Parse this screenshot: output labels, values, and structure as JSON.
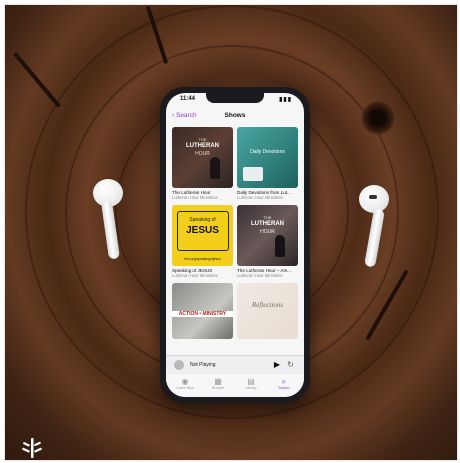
{
  "status": {
    "time": "11:44",
    "signal": "▮▮▮"
  },
  "nav": {
    "back_label": "Search",
    "title": "Shows"
  },
  "shows": [
    {
      "name": "The Lutheran Hour",
      "publisher": "Lutheran Hour Ministries",
      "art_top": "THE",
      "art_main": "LUTHERAN",
      "art_bottom": "HOUR"
    },
    {
      "name": "Daily Devotions from Lut...",
      "publisher": "Lutheran Hour Ministries",
      "art_main": "Daily Devotions"
    },
    {
      "name": "Speaking of JESUS",
      "publisher": "Lutheran Hour Ministries",
      "art_top": "Speaking of",
      "art_main": "JESUS",
      "art_bottom": "lhm.org/speakingofjesus"
    },
    {
      "name": "The Lutheran Hour – Am...",
      "publisher": "Lutheran Hour Ministries",
      "art_top": "THE",
      "art_main": "LUTHERAN",
      "art_bottom": "HOUR"
    },
    {
      "name": "",
      "publisher": "",
      "art_main": "ACTION • MINISTRY"
    },
    {
      "name": "",
      "publisher": "",
      "art_main": "Reflections"
    }
  ],
  "player": {
    "now_playing": "Not Playing"
  },
  "tabs": [
    {
      "label": "Listen Now",
      "icon": "◉",
      "active": false
    },
    {
      "label": "Browse",
      "icon": "▦",
      "active": false
    },
    {
      "label": "Library",
      "icon": "▤",
      "active": false
    },
    {
      "label": "Search",
      "icon": "⌕",
      "active": true
    }
  ],
  "colors": {
    "accent": "#8b3fd1",
    "wood": "#5a321d"
  }
}
